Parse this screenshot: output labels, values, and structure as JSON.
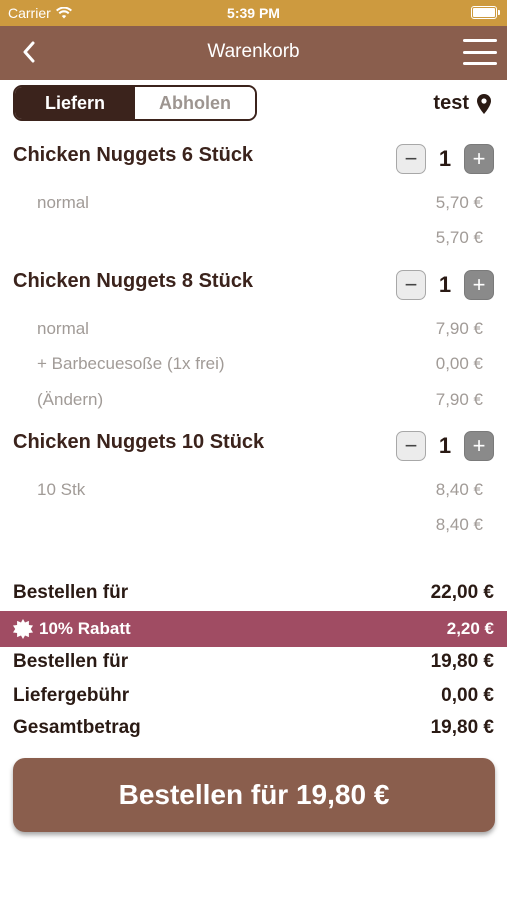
{
  "status_bar": {
    "carrier": "Carrier",
    "time": "5:39 PM"
  },
  "nav": {
    "title": "Warenkorb",
    "back_icon": "chevron-left-icon",
    "menu_icon": "hamburger-menu-icon"
  },
  "delivery_mode": {
    "options": [
      "Liefern",
      "Abholen"
    ],
    "selected": "Liefern"
  },
  "store": {
    "name": "test",
    "icon": "location-pin-icon"
  },
  "items": [
    {
      "title": "Chicken Nuggets 6 Stück",
      "quantity": "1",
      "lines": [
        {
          "label": "normal",
          "price": "5,70 €"
        }
      ],
      "total": "5,70 €"
    },
    {
      "title": "Chicken Nuggets 8 Stück",
      "quantity": "1",
      "lines": [
        {
          "label": "normal",
          "price": "7,90 €"
        },
        {
          "label": "+ Barbecuesoße (1x frei)",
          "price": "0,00 €"
        },
        {
          "label": "(Ändern)",
          "price": "7,90 €"
        }
      ]
    },
    {
      "title": "Chicken Nuggets 10 Stück",
      "quantity": "1",
      "lines": [
        {
          "label": "10 Stk",
          "price": "8,40 €"
        }
      ],
      "total": "8,40 €"
    }
  ],
  "summary": {
    "subtotal_label": "Bestellen für",
    "subtotal_value": "22,00 €",
    "discount_label": "10% Rabatt",
    "discount_value": "2,20 €",
    "after_discount_label": "Bestellen für",
    "after_discount_value": "19,80 €",
    "delivery_fee_label": "Liefergebühr",
    "delivery_fee_value": "0,00 €",
    "total_label": "Gesamtbetrag",
    "total_value": "19,80 €"
  },
  "order_button": {
    "label": "Bestellen für 19,80 €"
  },
  "colors": {
    "status_bar": "#cd9a3f",
    "nav_bar": "#8a5e4d",
    "segment_dark": "#3b231c",
    "discount_bar": "#a04c63",
    "order_button": "#8a5e4d"
  }
}
